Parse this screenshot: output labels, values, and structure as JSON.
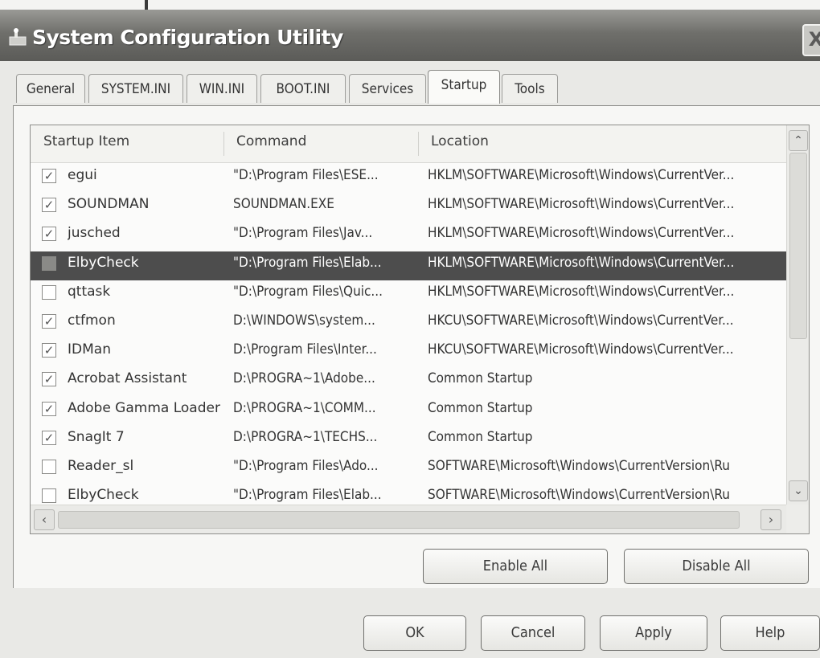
{
  "window": {
    "title": "System Configuration Utility",
    "close_glyph": "X"
  },
  "tabs": [
    {
      "label": "General"
    },
    {
      "label": "SYSTEM.INI"
    },
    {
      "label": "WIN.INI"
    },
    {
      "label": "BOOT.INI"
    },
    {
      "label": "Services"
    },
    {
      "label": "Startup",
      "active": true
    },
    {
      "label": "Tools"
    }
  ],
  "startup_list": {
    "columns": [
      "Startup Item",
      "Command",
      "Location"
    ],
    "rows": [
      {
        "checked": true,
        "item": "egui",
        "command": "\"D:\\Program Files\\ESE...",
        "location": "HKLM\\SOFTWARE\\Microsoft\\Windows\\CurrentVer..."
      },
      {
        "checked": true,
        "item": "SOUNDMAN",
        "command": "SOUNDMAN.EXE",
        "location": "HKLM\\SOFTWARE\\Microsoft\\Windows\\CurrentVer..."
      },
      {
        "checked": true,
        "item": "jusched",
        "command": "\"D:\\Program Files\\Jav...",
        "location": "HKLM\\SOFTWARE\\Microsoft\\Windows\\CurrentVer..."
      },
      {
        "checked": false,
        "item": "ElbyCheck",
        "command": "\"D:\\Program Files\\Elab...",
        "location": "HKLM\\SOFTWARE\\Microsoft\\Windows\\CurrentVer...",
        "selected": true
      },
      {
        "checked": false,
        "item": "qttask",
        "command": "\"D:\\Program Files\\Quic...",
        "location": "HKLM\\SOFTWARE\\Microsoft\\Windows\\CurrentVer..."
      },
      {
        "checked": true,
        "item": "ctfmon",
        "command": "D:\\WINDOWS\\system...",
        "location": "HKCU\\SOFTWARE\\Microsoft\\Windows\\CurrentVer..."
      },
      {
        "checked": true,
        "item": "IDMan",
        "command": "D:\\Program Files\\Inter...",
        "location": "HKCU\\SOFTWARE\\Microsoft\\Windows\\CurrentVer..."
      },
      {
        "checked": true,
        "item": "Acrobat Assistant",
        "command": "D:\\PROGRA~1\\Adobe...",
        "location": "Common Startup"
      },
      {
        "checked": true,
        "item": "Adobe Gamma Loader",
        "command": "D:\\PROGRA~1\\COMM...",
        "location": "Common Startup"
      },
      {
        "checked": true,
        "item": "SnagIt 7",
        "command": "D:\\PROGRA~1\\TECHS...",
        "location": "Common Startup"
      },
      {
        "checked": false,
        "item": "Reader_sl",
        "command": "\"D:\\Program Files\\Ado...",
        "location": "SOFTWARE\\Microsoft\\Windows\\CurrentVersion\\Ru"
      },
      {
        "checked": false,
        "item": "ElbyCheck",
        "command": "\"D:\\Program Files\\Elab...",
        "location": "SOFTWARE\\Microsoft\\Windows\\CurrentVersion\\Ru"
      }
    ],
    "check_glyph": "✓",
    "scroll_up_glyph": "⌃",
    "scroll_down_glyph": "⌄",
    "scroll_left_glyph": "‹",
    "scroll_right_glyph": "›"
  },
  "actions": {
    "enable_all": "Enable All",
    "disable_all": "Disable All"
  },
  "dialog_buttons": {
    "ok": "OK",
    "cancel": "Cancel",
    "apply": "Apply",
    "help": "Help"
  }
}
